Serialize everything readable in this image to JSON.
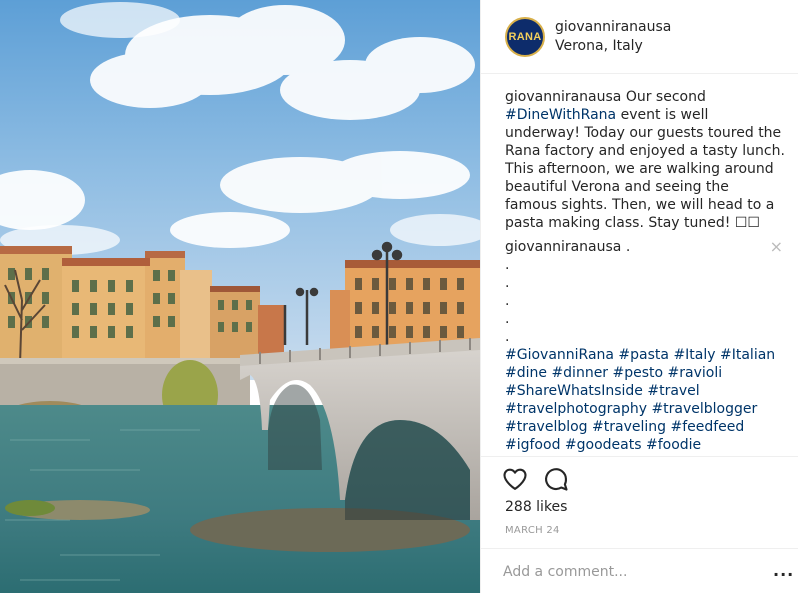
{
  "header": {
    "avatar_text": "RANA",
    "username": "giovanniranausa",
    "location": "Verona, Italy"
  },
  "caption": {
    "user": "giovanniranausa",
    "text_1": " Our second ",
    "hashtag": "#DineWithRana",
    "text_2": " event is well underway! Today our guests toured the Rana factory and enjoyed a tasty lunch. This afternoon, we are walking around beautiful Verona and seeing the famous sights. Then, we will head to a pasta making class. Stay tuned! ☐☐"
  },
  "comment": {
    "user": "giovanniranausa",
    "text": " .",
    "dots": [
      ".",
      ".",
      ".",
      ".",
      "."
    ],
    "hashtags": "#GiovanniRana #pasta #Italy #Italian #dine #dinner #pesto #ravioli #ShareWhatsInside #travel #travelphotography #travelblogger #travelblog #traveling #feedfeed #igfood #goodeats #foodie",
    "close_icon": "×"
  },
  "actions": {
    "likes": "288 likes",
    "date": "MARCH 24"
  },
  "add_comment": {
    "placeholder": "Add a comment...",
    "more_icon": "..."
  },
  "colors": {
    "hashtag": "#003569",
    "text": "#262626",
    "muted": "#999999",
    "avatar_bg": "#0d2c6b",
    "avatar_text": "#f3cf5c"
  }
}
